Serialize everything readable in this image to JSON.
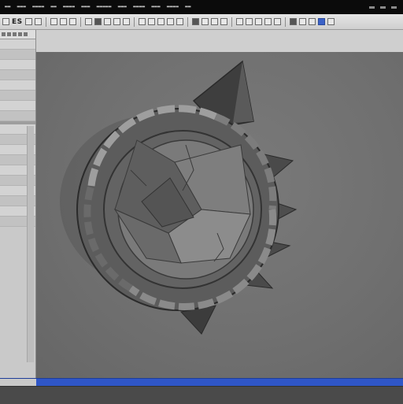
{
  "menubar": {
    "items": [
      "▬▬",
      "▬▬▬",
      "▬▬▬▬",
      "▬▬",
      "▬▬▬▬",
      "▬▬▬",
      "▬▬▬▬▬",
      "▬▬▬",
      "▬▬▬▬",
      "▬▬▬",
      "▬▬▬▬",
      "▬▬"
    ]
  },
  "toolbar": {
    "label": "ES"
  },
  "viewport": {
    "background": "#707070",
    "object_icon": "stone-ring-model-icon"
  },
  "colors": {
    "accent": "#2f56c7",
    "panel": "#c9c9c9",
    "menubar": "#0b0b0b"
  }
}
